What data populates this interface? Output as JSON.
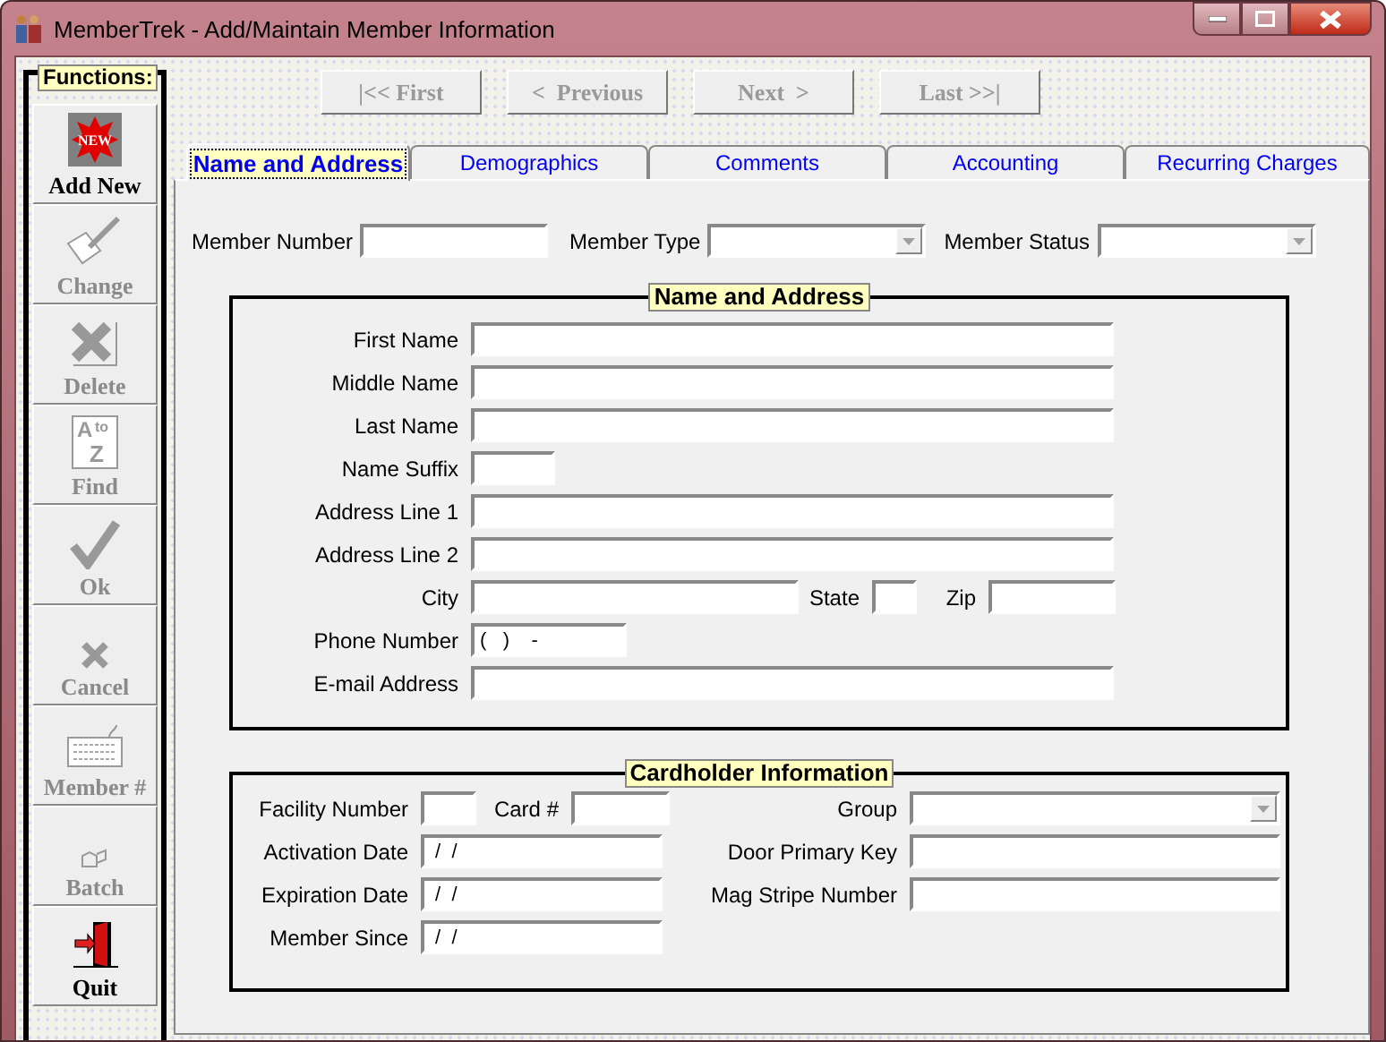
{
  "window": {
    "title": "MemberTrek - Add/Maintain Member Information"
  },
  "functions": {
    "title": "Functions:",
    "buttons": [
      {
        "kind": "new",
        "label": "Add New",
        "badge": "NEW",
        "disabled": false
      },
      {
        "kind": "change",
        "label": "Change",
        "disabled": true
      },
      {
        "kind": "delete",
        "label": "Delete",
        "disabled": true
      },
      {
        "kind": "find",
        "label": "Find",
        "icon_text": [
          "A",
          "to",
          "Z"
        ],
        "disabled": true
      },
      {
        "kind": "ok",
        "label": "Ok",
        "disabled": true
      },
      {
        "kind": "cancel",
        "label": "Cancel",
        "disabled": true
      },
      {
        "kind": "keyboard",
        "label": "Member #",
        "disabled": true
      },
      {
        "kind": "batch",
        "label": "Batch",
        "disabled": true
      },
      {
        "kind": "quit",
        "label": "Quit",
        "disabled": false
      }
    ]
  },
  "navigation": [
    {
      "label": "|<< First",
      "disabled": true
    },
    {
      "label": "<  Previous",
      "disabled": true
    },
    {
      "label": "Next  >",
      "disabled": true
    },
    {
      "label": "Last >>|",
      "disabled": true
    }
  ],
  "tabs": [
    {
      "label": "Name and Address",
      "selected": true
    },
    {
      "label": "Demographics",
      "selected": false
    },
    {
      "label": "Comments",
      "selected": false
    },
    {
      "label": "Accounting",
      "selected": false
    },
    {
      "label": "Recurring Charges",
      "selected": false
    }
  ],
  "member_fields": [
    {
      "label": "Member Number",
      "kind": "text"
    },
    {
      "label": "Member Type",
      "kind": "combo"
    },
    {
      "label": "Member Status",
      "kind": "combo"
    }
  ],
  "name_and_address": {
    "title": "Name and Address",
    "fields": [
      {
        "label": "First Name",
        "kind": "text"
      },
      {
        "label": "Middle Name",
        "kind": "text"
      },
      {
        "label": "Last Name",
        "kind": "text"
      },
      {
        "label": "Name Suffix",
        "kind": "text"
      },
      {
        "label": "Address Line 1",
        "kind": "text"
      },
      {
        "label": "Address Line 2",
        "kind": "text"
      },
      {
        "label": "City",
        "kind": "text"
      },
      {
        "label": "State",
        "kind": "text"
      },
      {
        "label": "Zip",
        "kind": "text"
      },
      {
        "label": "Phone Number",
        "kind": "text",
        "value": "(   )    -"
      },
      {
        "label": "E-mail Address",
        "kind": "text"
      }
    ]
  },
  "cardholder": {
    "title": "Cardholder Information",
    "fields": [
      {
        "label": "Facility Number",
        "kind": "text"
      },
      {
        "label": "Card #",
        "kind": "text"
      },
      {
        "label": "Activation Date",
        "kind": "text",
        "value": " /  /"
      },
      {
        "label": "Expiration Date",
        "kind": "text",
        "value": " /  /"
      },
      {
        "label": "Member Since",
        "kind": "text",
        "value": " /  /"
      },
      {
        "label": "Group",
        "kind": "combo"
      },
      {
        "label": "Door Primary Key",
        "kind": "text"
      },
      {
        "label": "Mag Stripe Number",
        "kind": "text"
      }
    ]
  }
}
